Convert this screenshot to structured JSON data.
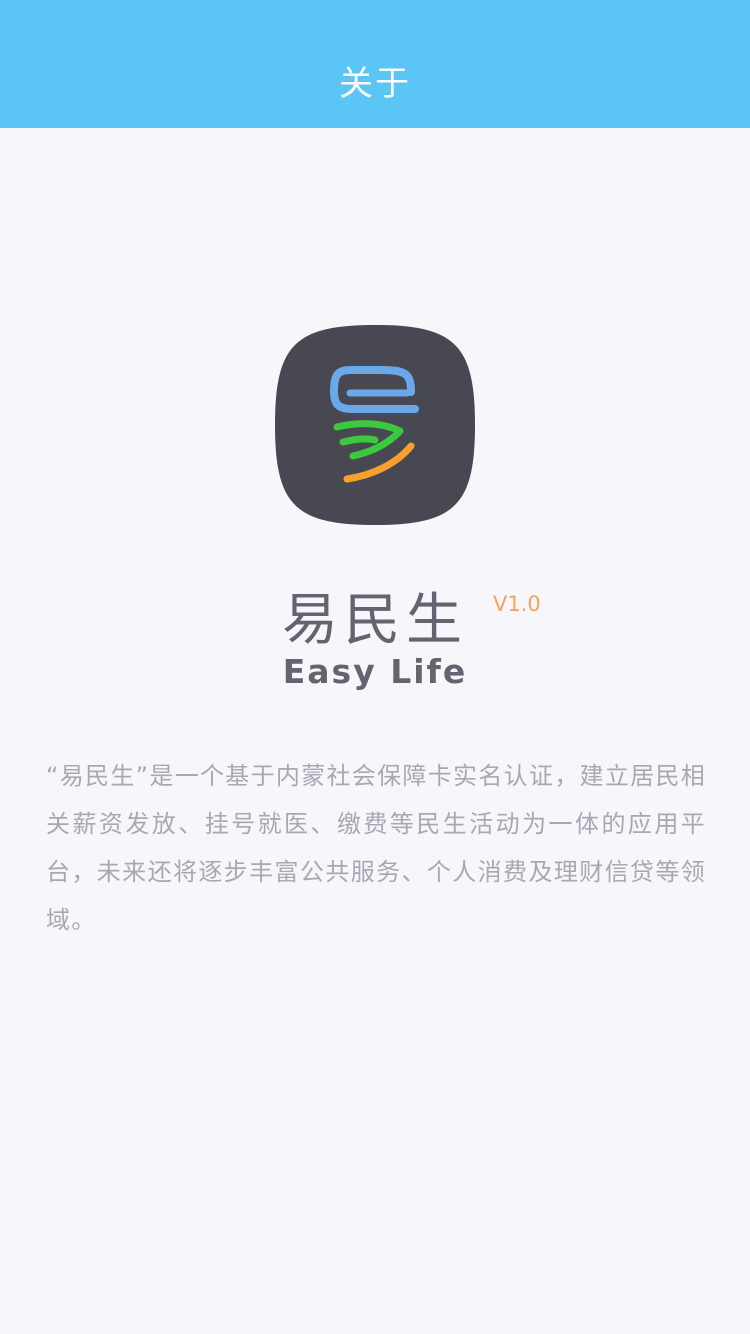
{
  "header": {
    "title": "关于",
    "background_color": "#5bc6f5"
  },
  "logo": {
    "icon": "easy-life-logo-icon",
    "background_color": "#484853",
    "stroke_colors": [
      "#6aa9e9",
      "#3cc93d",
      "#f7a12c"
    ]
  },
  "app": {
    "name": "易民生",
    "name_en": "Easy Life",
    "version": "V1.0",
    "version_color": "#f5a35e"
  },
  "description": "“易民生”是一个基于内蒙社会保障卡实名认证，建立居民相关薪资发放、挂号就医、缴费等民生活动为一体的应用平台，未来还将逐步丰富公共服务、个人消费及理财信贷等领域。"
}
